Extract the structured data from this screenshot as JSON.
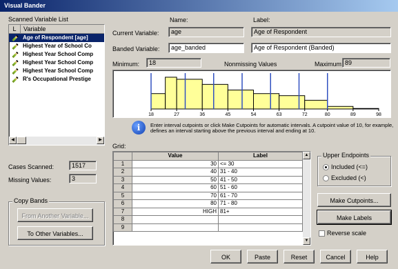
{
  "window": {
    "title": "Visual Bander"
  },
  "scanned": {
    "label": "Scanned Variable List",
    "col_l": "L",
    "col_var": "Variable",
    "items": [
      "Age of Respondent [age]",
      "Highest Year of School Co",
      "Highest Year School Comp",
      "Highest Year School Comp",
      "Highest Year School Comp",
      "R's Occupational Prestige"
    ]
  },
  "variable": {
    "name_header": "Name:",
    "label_header": "Label:",
    "current_label": "Current Variable:",
    "current_name": "age",
    "current_var_label": "Age of Respondent",
    "banded_label": "Banded Variable:",
    "banded_name": "age_banded",
    "banded_var_label": "Age of Respondent (Banded)"
  },
  "range": {
    "min_label": "Minimum:",
    "min_value": "18",
    "nonmissing_label": "Nonmissing Values",
    "max_label": "Maximum:",
    "max_value": "89"
  },
  "chart_data": {
    "type": "bar",
    "x_ticks": [
      "18",
      "27",
      "36",
      "45",
      "54",
      "63",
      "72",
      "80",
      "89",
      "98"
    ],
    "bin_edges": [
      18,
      23,
      27,
      36,
      45,
      54,
      63,
      72,
      80,
      89,
      98
    ],
    "values": [
      30,
      62,
      58,
      48,
      37,
      30,
      26,
      17,
      5,
      1
    ],
    "cutpoints": [
      18,
      30,
      40,
      50,
      60,
      70,
      80
    ],
    "ylim": [
      0,
      70
    ],
    "bar_color": "#ffff99",
    "cut_color": "#3050c0"
  },
  "info": {
    "text": "Enter interval cutpoints or click Make Cutpoints for automatic intervals. A cutpoint value of 10, for example, defines an interval starting above the previous interval and ending at 10."
  },
  "stats": {
    "cases_label": "Cases Scanned:",
    "cases_value": "1517",
    "missing_label": "Missing Values:",
    "missing_value": "3"
  },
  "copy_bands": {
    "label": "Copy Bands",
    "from_button": "From Another Variable...",
    "to_button": "To Other Variables..."
  },
  "grid": {
    "label": "Grid:",
    "col_value": "Value",
    "col_label": "Label",
    "rows": [
      {
        "num": "1",
        "value": "30",
        "label": "<= 30"
      },
      {
        "num": "2",
        "value": "40",
        "label": "31 - 40"
      },
      {
        "num": "3",
        "value": "50",
        "label": "41 - 50"
      },
      {
        "num": "4",
        "value": "60",
        "label": "51 - 60"
      },
      {
        "num": "5",
        "value": "70",
        "label": "61 - 70"
      },
      {
        "num": "6",
        "value": "80",
        "label": "71 - 80"
      },
      {
        "num": "7",
        "value": "HIGH",
        "label": "81+"
      },
      {
        "num": "8",
        "value": "",
        "label": ""
      },
      {
        "num": "9",
        "value": "",
        "label": ""
      }
    ]
  },
  "endpoints": {
    "label": "Upper Endpoints",
    "included": "Included (<=)",
    "excluded": "Excluded (<)",
    "selected": "included"
  },
  "buttons": {
    "make_cutpoints": "Make Cutpoints...",
    "make_labels": "Make Labels",
    "reverse_scale": "Reverse scale",
    "ok": "OK",
    "paste": "Paste",
    "reset": "Reset",
    "cancel": "Cancel",
    "help": "Help"
  }
}
